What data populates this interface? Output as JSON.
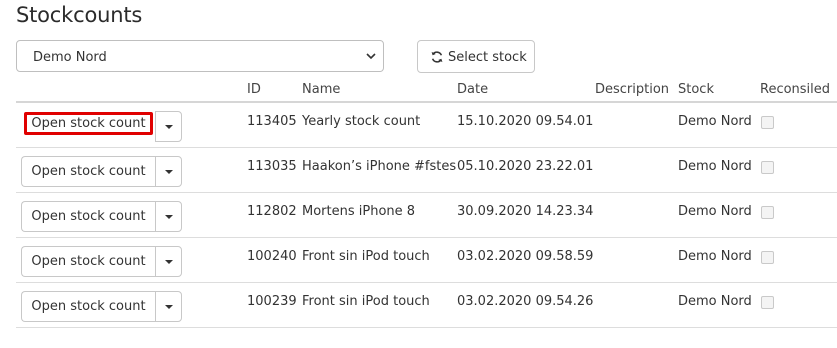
{
  "page": {
    "title": "Stockcounts"
  },
  "stock_select": {
    "value": "Demo Nord"
  },
  "select_stock_button": {
    "label": "Select stock"
  },
  "table": {
    "columns": {
      "id": "ID",
      "name": "Name",
      "date": "Date",
      "description": "Description",
      "stock": "Stock",
      "reconsiled": "Reconsiled"
    },
    "rows": [
      {
        "action": "Open stock count",
        "id": "113405",
        "name": "Yearly stock count",
        "date": "15.10.2020 09.54.01",
        "description": "",
        "stock": "Demo Nord",
        "reconsiled": false
      },
      {
        "action": "Open stock count",
        "id": "113035",
        "name": "Haakon’s iPhone #fstes",
        "date": "05.10.2020 23.22.01",
        "description": "",
        "stock": "Demo Nord",
        "reconsiled": false
      },
      {
        "action": "Open stock count",
        "id": "112802",
        "name": "Mortens iPhone 8",
        "date": "30.09.2020 14.23.34",
        "description": "",
        "stock": "Demo Nord",
        "reconsiled": false
      },
      {
        "action": "Open stock count",
        "id": "100240",
        "name": "Front sin iPod touch",
        "date": "03.02.2020 09.58.59",
        "description": "",
        "stock": "Demo Nord",
        "reconsiled": false
      },
      {
        "action": "Open stock count",
        "id": "100239",
        "name": "Front sin iPod touch",
        "date": "03.02.2020 09.54.26",
        "description": "",
        "stock": "Demo Nord",
        "reconsiled": false
      }
    ]
  },
  "highlight_color": "#e00000"
}
